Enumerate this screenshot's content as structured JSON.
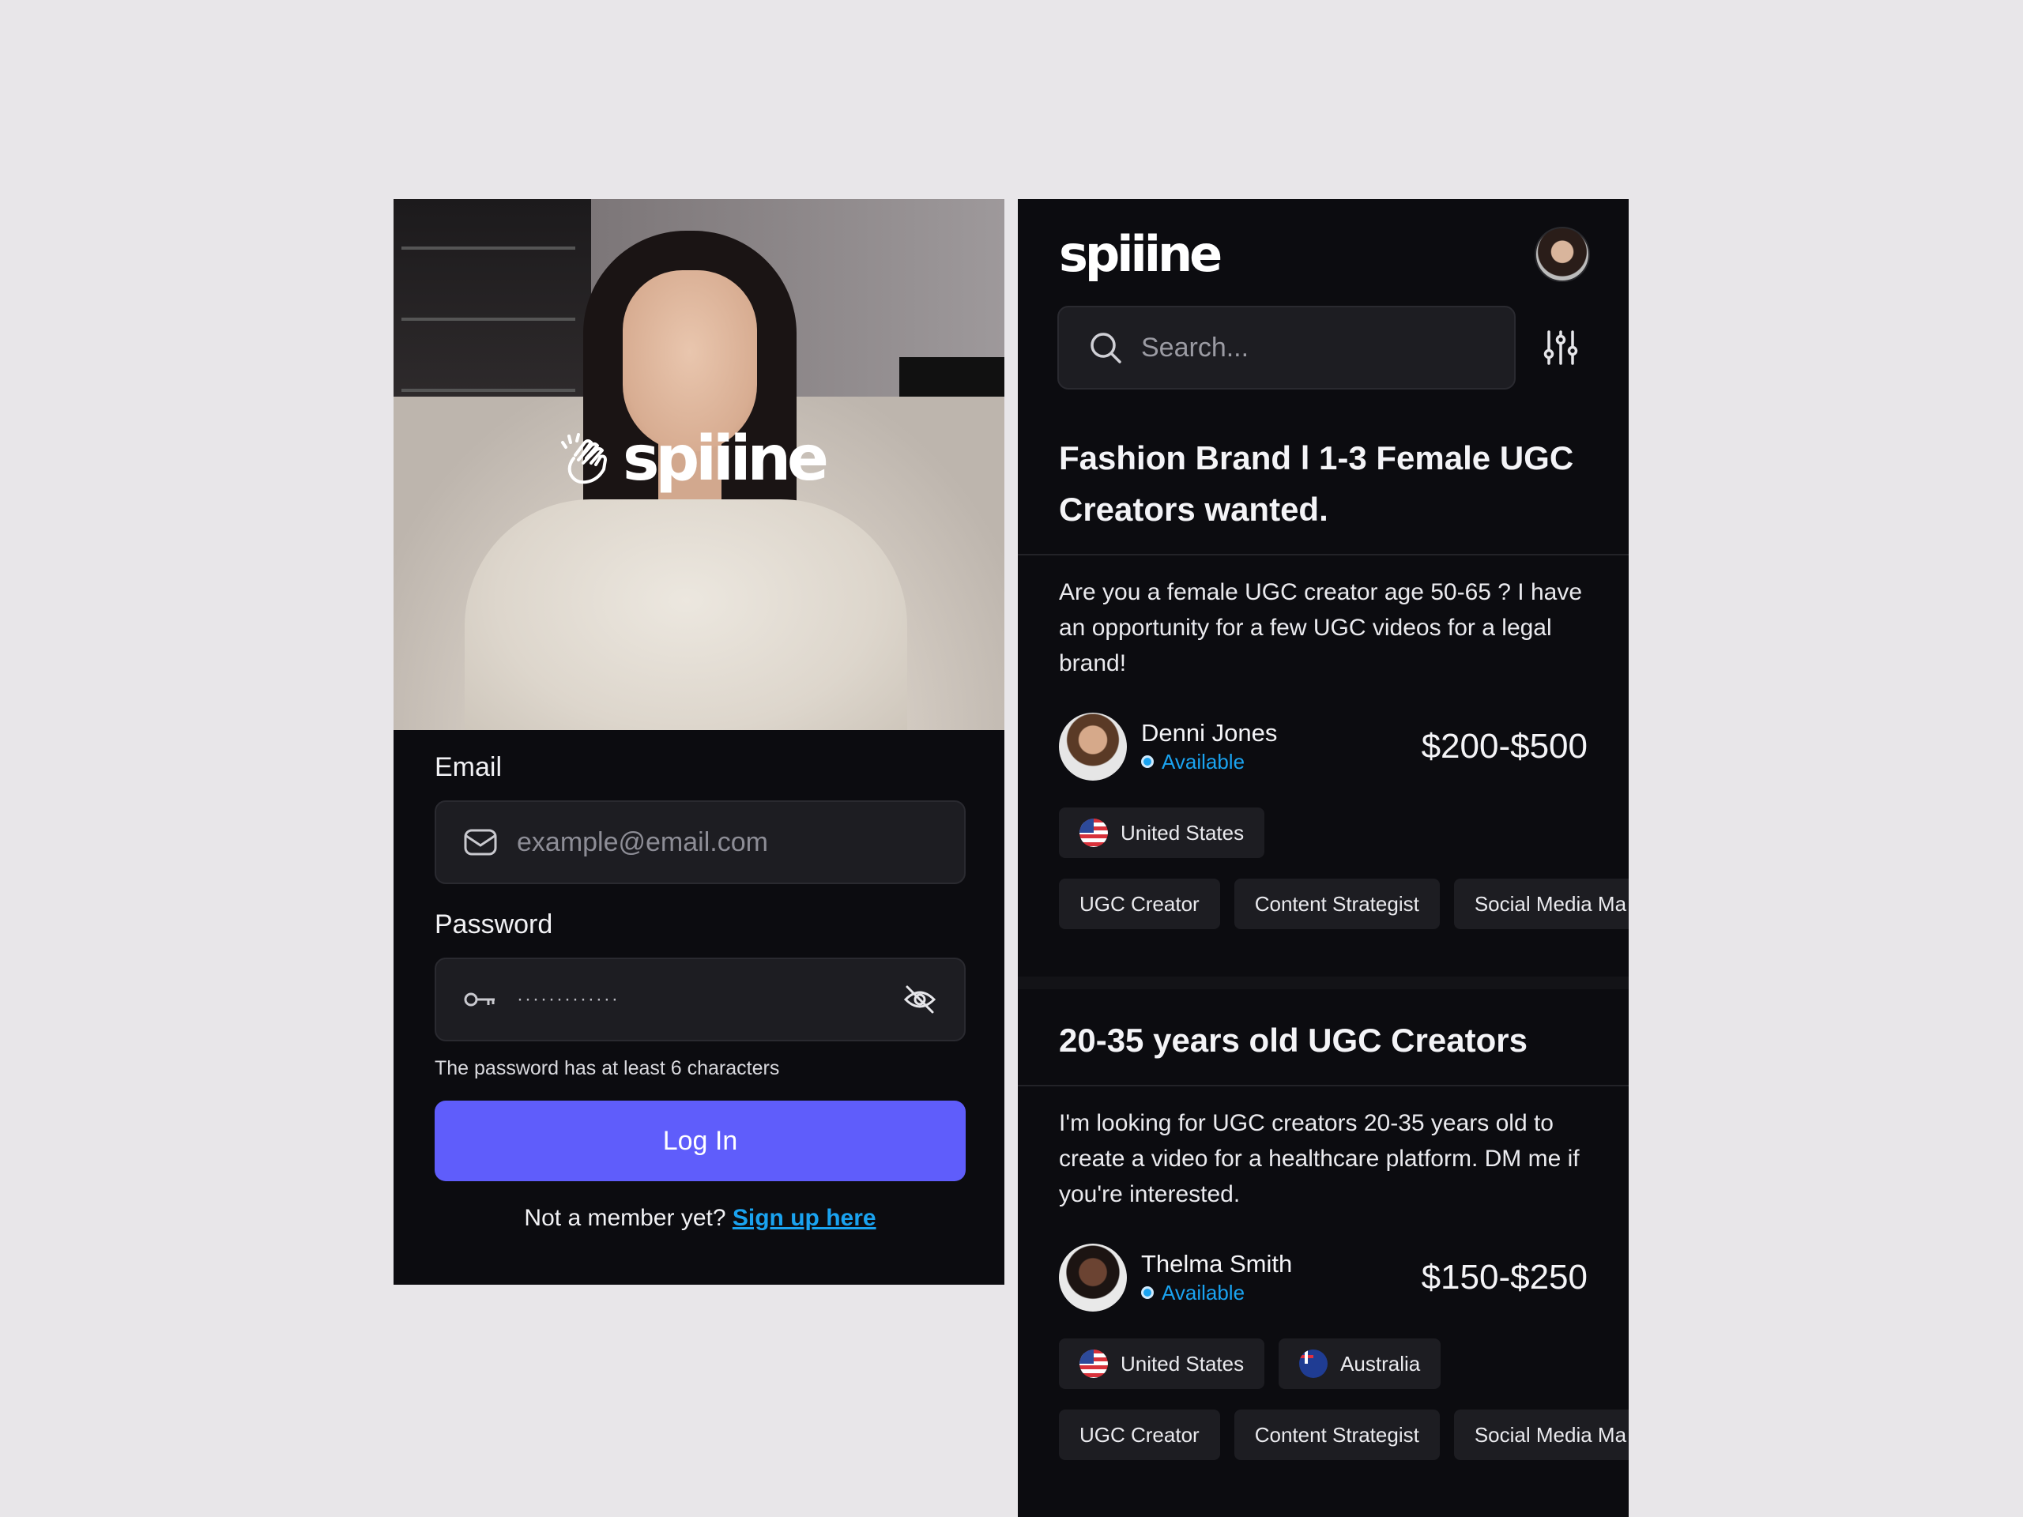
{
  "brand": {
    "name": "spiiine"
  },
  "login": {
    "email_label": "Email",
    "email_placeholder": "example@email.com",
    "password_label": "Password",
    "password_value": "·············",
    "password_hint": "The password has at least 6 characters",
    "login_button": "Log In",
    "signup_prompt": "Not a member yet?",
    "signup_link": "Sign up here"
  },
  "feed": {
    "search_placeholder": "Search...",
    "posts": [
      {
        "title": "Fashion Brand l 1-3 Female UGC Creators wanted.",
        "description": "Are you a female UGC creator age 50-65 ? I have an opportunity for a few UGC videos for a legal brand!",
        "author": "Denni Jones",
        "status": "Available",
        "price": "$200-$500",
        "locations": [
          "United States"
        ],
        "tags": [
          "UGC Creator",
          "Content Strategist",
          "Social Media Ma"
        ]
      },
      {
        "title": "20-35 years old UGC Creators",
        "description": "I'm looking for UGC creators 20-35 years old to create a video for a healthcare platform. DM me if you're interested.",
        "author": "Thelma Smith",
        "status": "Available",
        "price": "$150-$250",
        "locations": [
          "United States",
          "Australia"
        ],
        "tags": [
          "UGC Creator",
          "Content Strategist",
          "Social Media Ma"
        ]
      }
    ]
  },
  "colors": {
    "accent": "#5f5dfb",
    "link": "#1aa3f0",
    "panel": "#0c0c10",
    "page": "#e8e6e9"
  },
  "icons": [
    "clap-icon",
    "mail-icon",
    "key-icon",
    "eye-off-icon",
    "search-icon",
    "filter-sliders-icon",
    "us-flag-icon",
    "australia-flag-icon"
  ]
}
